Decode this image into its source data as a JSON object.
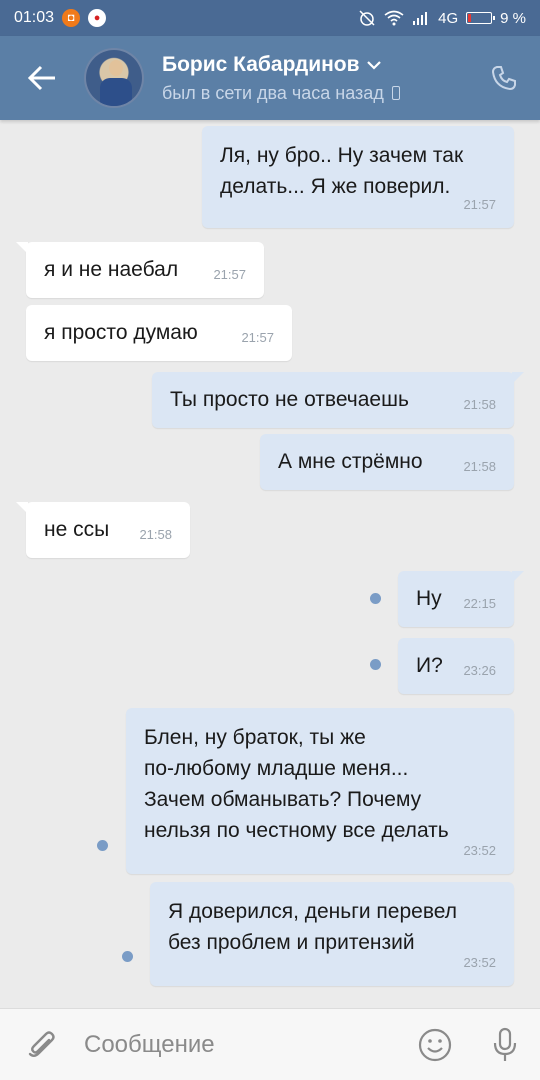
{
  "status_bar": {
    "time": "01:03",
    "network": "4G",
    "battery": "9 %"
  },
  "header": {
    "contact_name": "Борис Кабардинов",
    "contact_status": "был в сети два часа назад"
  },
  "messages": [
    {
      "dir": "out",
      "text": "Ля, ну бро.. Ну зачем так\nделать... Я же поверил.",
      "time": "21:57"
    },
    {
      "dir": "in",
      "text": "я и не наебал",
      "time": "21:57"
    },
    {
      "dir": "in",
      "text": "я просто думаю",
      "time": "21:57"
    },
    {
      "dir": "out",
      "text": "Ты просто не отвечаешь",
      "time": "21:58"
    },
    {
      "dir": "out",
      "text": "А мне стрёмно",
      "time": "21:58"
    },
    {
      "dir": "in",
      "text": "не ссы",
      "time": "21:58"
    },
    {
      "dir": "out",
      "text": "Ну",
      "time": "22:15",
      "unread": true
    },
    {
      "dir": "out",
      "text": "И?",
      "time": "23:26",
      "unread": true
    },
    {
      "dir": "out",
      "text": "Блен, ну браток, ты же\nпо-любому младше меня...\nЗачем обманывать? Почему\nнельзя по честному все делать",
      "time": "23:52",
      "unread": true
    },
    {
      "dir": "out",
      "text": "Я доверился, деньги перевел\nбез проблем и притензий",
      "time": "23:52",
      "unread": true
    }
  ],
  "input": {
    "placeholder": "Сообщение"
  },
  "colors": {
    "header_bg": "#5b7fa6",
    "status_bg": "#4a6a94",
    "outgoing_bubble": "#dbe6f4",
    "incoming_bubble": "#ffffff",
    "unread_dot": "#7a9cc6"
  },
  "icons": [
    "back-arrow-icon",
    "chevron-down-icon",
    "phone-icon",
    "attach-icon",
    "emoji-icon",
    "mic-icon",
    "wifi-icon",
    "signal-icon",
    "battery-icon",
    "alarm-off-icon"
  ]
}
